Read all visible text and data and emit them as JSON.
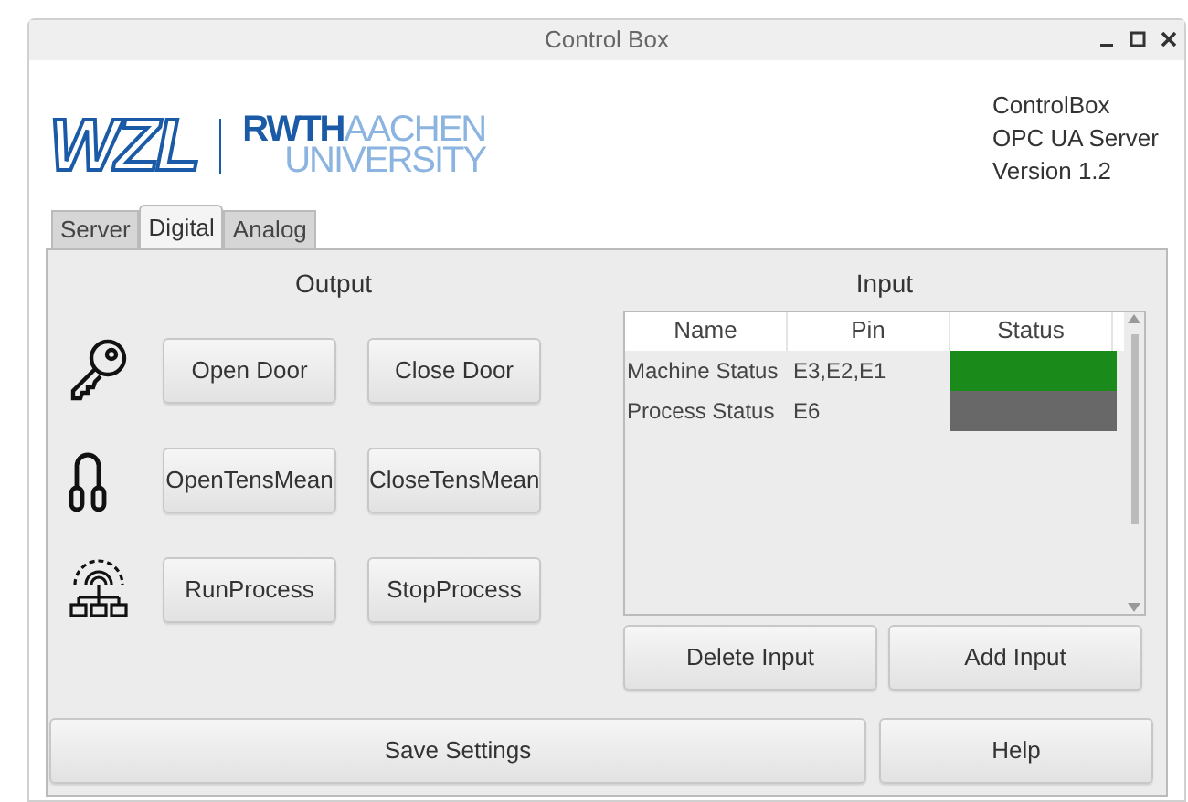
{
  "window": {
    "title": "Control Box"
  },
  "logo": {
    "left": "WZL",
    "brand": "RWTH",
    "city": "AACHEN",
    "line2": "UNIVERSITY"
  },
  "info": [
    "ControlBox",
    "OPC UA Server",
    "Version 1.2"
  ],
  "tabs": [
    {
      "label": "Server",
      "selected": false
    },
    {
      "label": "Digital",
      "selected": true
    },
    {
      "label": "Analog",
      "selected": false
    }
  ],
  "output": {
    "title": "Output",
    "rows": [
      {
        "kind": "key",
        "buttons": [
          "Open Door",
          "Close Door"
        ]
      },
      {
        "kind": "clamp",
        "buttons": [
          "OpenTensMean",
          "CloseTensMean"
        ]
      },
      {
        "kind": "process",
        "buttons": [
          "RunProcess",
          "StopProcess"
        ]
      }
    ]
  },
  "input": {
    "title": "Input",
    "columns": [
      "Name",
      "Pin",
      "Status"
    ],
    "rows": [
      {
        "name": "Machine Status",
        "pin": "E3,E2,E1",
        "color": "#1a8a1a"
      },
      {
        "name": "Process Status",
        "pin": "E6",
        "color": "#686868"
      }
    ],
    "buttons": [
      "Delete Input",
      "Add Input"
    ]
  },
  "footer": [
    "Save Settings",
    "Help"
  ]
}
